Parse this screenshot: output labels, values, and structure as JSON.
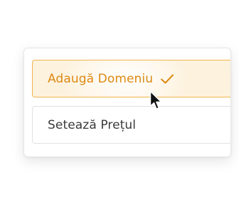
{
  "menu": {
    "options": [
      {
        "label": "Adaugă Domeniu",
        "state": "selected",
        "icon": "check-icon"
      },
      {
        "label": "Setează Prețul",
        "state": "default"
      }
    ]
  },
  "colors": {
    "accent": "#dc8a14",
    "accent_border": "#f0b44c",
    "selected_bg": "#fdf2de",
    "text": "#3a3a3a",
    "border": "#e2e2e2"
  },
  "pointer": {
    "icon": "mouse-pointer-icon"
  }
}
